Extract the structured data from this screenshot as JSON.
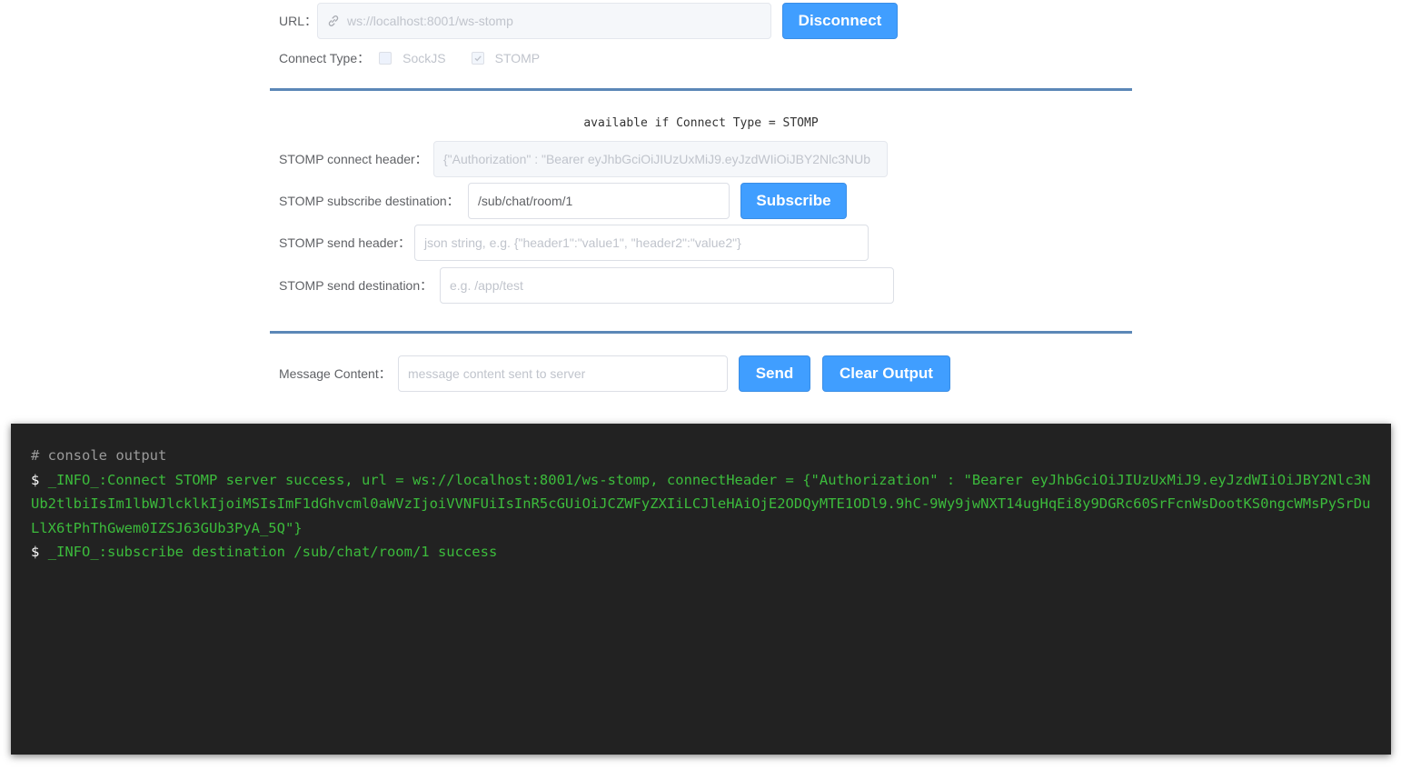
{
  "connection": {
    "url_label": "URL：",
    "url_value": "ws://localhost:8001/ws-stomp",
    "disconnect_label": "Disconnect",
    "connect_type_label": "Connect Type：",
    "sockjs_label": "SockJS",
    "sockjs_checked": false,
    "stomp_label": "STOMP",
    "stomp_checked": true
  },
  "stomp": {
    "hint": "available if Connect Type = STOMP",
    "connect_header_label": "STOMP connect header：",
    "connect_header_value": "{\"Authorization\" : \"Bearer eyJhbGciOiJIUzUxMiJ9.eyJzdWIiOiJBY2Nlc3NUb",
    "subscribe_destination_label": "STOMP subscribe destination：",
    "subscribe_destination_value": "/sub/chat/room/1",
    "subscribe_label": "Subscribe",
    "send_header_label": "STOMP send header：",
    "send_header_placeholder": "json string, e.g. {\"header1\":\"value1\", \"header2\":\"value2\"}",
    "send_destination_label": "STOMP send destination：",
    "send_destination_placeholder": "e.g. /app/test"
  },
  "message": {
    "content_label": "Message Content：",
    "content_placeholder": "message content sent to server",
    "send_label": "Send",
    "clear_label": "Clear Output"
  },
  "console": {
    "title": "# console output",
    "prompt": "$",
    "lines": [
      "_INFO_:Connect STOMP server success, url = ws://localhost:8001/ws-stomp, connectHeader = {\"Authorization\" : \"Bearer eyJhbGciOiJIUzUxMiJ9.eyJzdWIiOiJBY2Nlc3NUb2tlbiIsIm1lbWJlcklkIjoiMSIsImF1dGhvcml0aWVzIjoiVVNFUiIsInR5cGUiOiJCZWFyZXIiLCJleHAiOjE2ODQyMTE1ODl9.9hC-9Wy9jwNXT14ugHqEi8y9DGRc60SrFcnWsDootKS0ngcWMsPySrDuLlX6tPhThGwem0IZSJ63GUb3PyA_5Q\"}",
      "_INFO_:subscribe destination /sub/chat/room/1 success"
    ]
  }
}
